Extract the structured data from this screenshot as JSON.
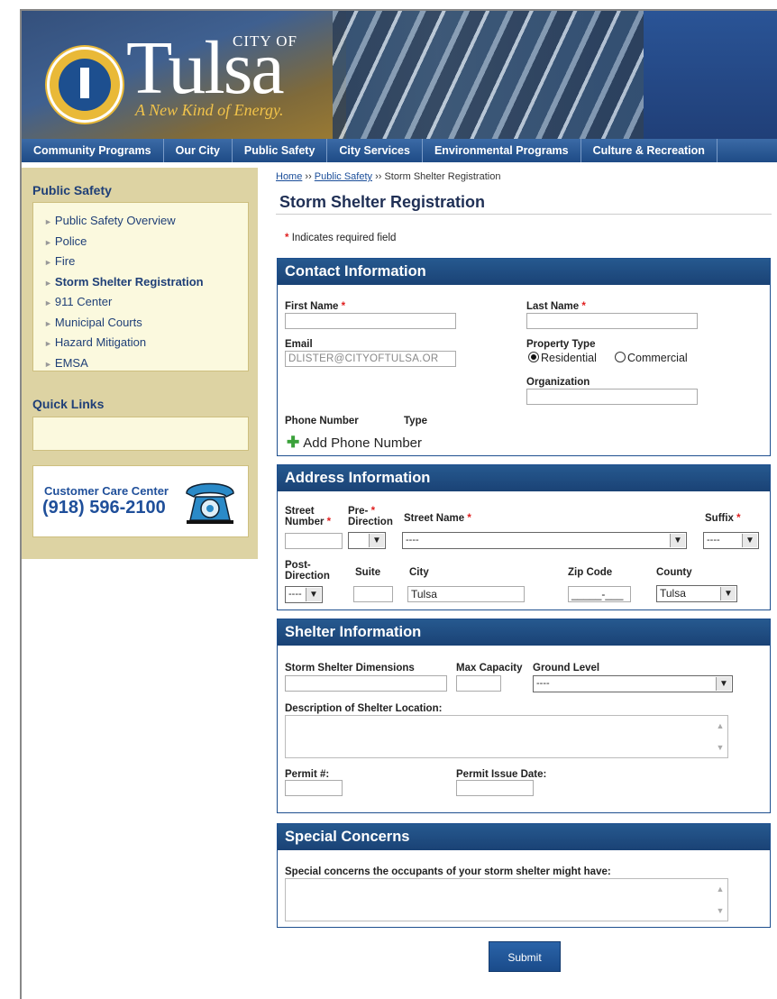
{
  "header": {
    "city_of": "CITY OF",
    "city_name": "Tulsa",
    "tagline": "A New Kind of Energy."
  },
  "nav": {
    "items": [
      "Community Programs",
      "Our City",
      "Public Safety",
      "City Services",
      "Environmental Programs",
      "Culture & Recreation"
    ]
  },
  "sidebar": {
    "heading": "Public Safety",
    "items": [
      {
        "label": "Public Safety Overview"
      },
      {
        "label": "Police"
      },
      {
        "label": "Fire"
      },
      {
        "label": "Storm Shelter Registration"
      },
      {
        "label": "911 Center"
      },
      {
        "label": "Municipal Courts"
      },
      {
        "label": "Hazard Mitigation"
      },
      {
        "label": "EMSA"
      }
    ],
    "quick_links": "Quick Links",
    "care_line1": "Customer Care Center",
    "care_line2": "(918) 596-2100"
  },
  "breadcrumb": {
    "home": "Home",
    "sep": "››",
    "section": "Public Safety",
    "current": "Storm Shelter Registration"
  },
  "page": {
    "title": "Storm Shelter Registration",
    "required_star": "*",
    "required_note": "Indicates required field"
  },
  "contact": {
    "heading": "Contact Information",
    "first_name": "First Name",
    "last_name": "Last Name",
    "email": "Email",
    "email_value": "DLISTER@CITYOFTULSA.OR",
    "property_type": "Property Type",
    "residential": "Residential",
    "commercial": "Commercial",
    "organization": "Organization",
    "phone_number": "Phone Number",
    "type": "Type",
    "add_phone": "Add Phone Number"
  },
  "address": {
    "heading": "Address Information",
    "street_number_1": "Street",
    "street_number_2": "Number",
    "pre_1": "Pre-",
    "pre_2": "Direction",
    "street_name": "Street Name",
    "suffix": "Suffix",
    "dash": "----",
    "post_1": "Post-",
    "post_2": "Direction",
    "suite": "Suite",
    "city": "City",
    "city_value": "Tulsa",
    "zip": "Zip Code",
    "zip_value": "_____-___",
    "county": "County",
    "county_value": "Tulsa"
  },
  "shelter": {
    "heading": "Shelter Information",
    "dimensions": "Storm Shelter Dimensions",
    "max_capacity": "Max Capacity",
    "ground_level": "Ground Level",
    "ground_value": "----",
    "description": "Description of Shelter Location:",
    "permit": "Permit #:",
    "permit_date": "Permit Issue Date:"
  },
  "concerns": {
    "heading": "Special Concerns",
    "prompt": "Special concerns the occupants of your storm shelter might have:"
  },
  "submit_label": "Submit"
}
